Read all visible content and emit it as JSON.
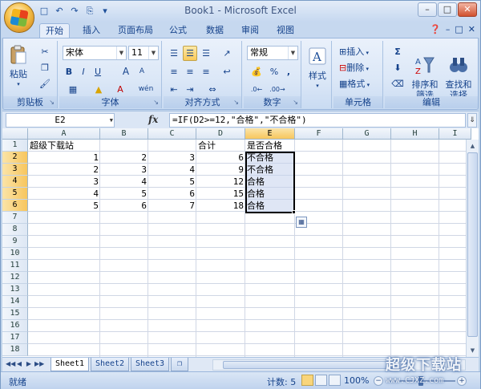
{
  "title": "Book1 - Microsoft Excel",
  "qat": {
    "save": "save-icon",
    "undo": "undo-icon",
    "redo": "redo-icon"
  },
  "window_controls": {
    "minimize": "–",
    "maximize": "□",
    "close": "✕"
  },
  "tabs": [
    {
      "label": "开始",
      "active": true
    },
    {
      "label": "插入"
    },
    {
      "label": "页面布局"
    },
    {
      "label": "公式"
    },
    {
      "label": "数据"
    },
    {
      "label": "审阅"
    },
    {
      "label": "视图"
    }
  ],
  "ribbon": {
    "clipboard": {
      "label": "剪贴板",
      "paste": "粘贴"
    },
    "font": {
      "label": "字体",
      "name": "宋体",
      "size": "11",
      "bold": "B",
      "italic": "I",
      "underline": "U",
      "grow": "A",
      "shrink": "A",
      "fontcolor": "A",
      "wen": "wén"
    },
    "alignment": {
      "label": "对齐方式"
    },
    "number": {
      "label": "数字",
      "format": "常规",
      "percent": "%",
      "comma": ","
    },
    "styles": {
      "label": "样式"
    },
    "cells": {
      "label": "单元格",
      "insert": "插入",
      "delete": "删除",
      "format": "格式"
    },
    "editing": {
      "label": "编辑",
      "sum": "Σ",
      "sort": "排序和\n筛选",
      "find": "查找和\n选择"
    }
  },
  "formula_bar": {
    "name_box": "E2",
    "fx": "fx",
    "formula": "=IF(D2>=12,\"合格\",\"不合格\")"
  },
  "columns": [
    "A",
    "B",
    "C",
    "D",
    "E",
    "F",
    "G",
    "H",
    "I"
  ],
  "rows": [
    "1",
    "2",
    "3",
    "4",
    "5",
    "6",
    "7",
    "8",
    "9",
    "10",
    "11",
    "12",
    "13",
    "14",
    "15",
    "16",
    "17",
    "18"
  ],
  "cells": {
    "A1": "超级下载站",
    "D1": "合计",
    "E1": "是否合格",
    "A2": "1",
    "B2": "2",
    "C2": "3",
    "D2": "6",
    "E2": "不合格",
    "A3": "2",
    "B3": "3",
    "C3": "4",
    "D3": "9",
    "E3": "不合格",
    "A4": "3",
    "B4": "4",
    "C4": "5",
    "D4": "12",
    "E4": "合格",
    "A5": "4",
    "B5": "5",
    "C5": "6",
    "D5": "15",
    "E5": "合格",
    "A6": "5",
    "B6": "6",
    "C6": "7",
    "D6": "18",
    "E6": "合格"
  },
  "sheets": [
    {
      "label": "Sheet1",
      "active": true
    },
    {
      "label": "Sheet2"
    },
    {
      "label": "Sheet3"
    }
  ],
  "status": {
    "ready": "就绪",
    "count": "计数: 5",
    "zoom": "100%"
  },
  "watermark": {
    "line1": "超级下载站",
    "line2": "www.CJXZ.com"
  }
}
